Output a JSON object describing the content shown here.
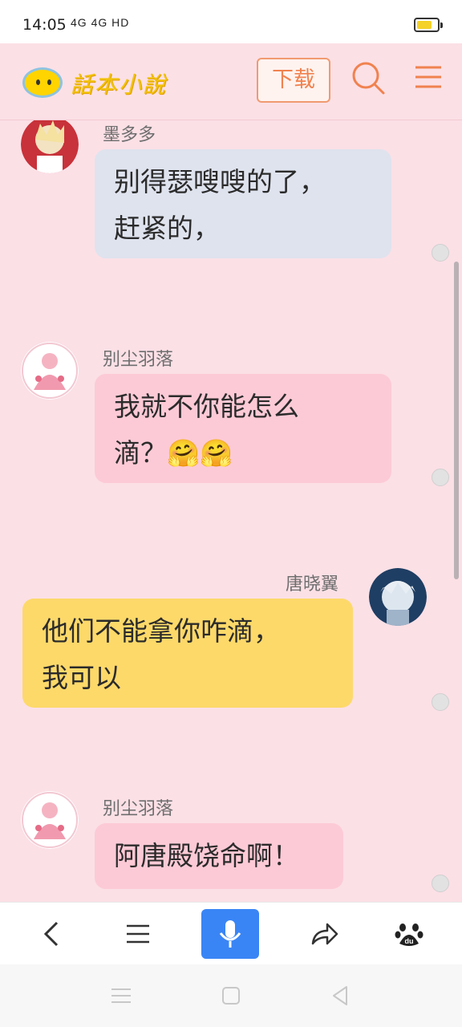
{
  "status": {
    "time": "14:05",
    "network": "4G 4G HD",
    "battery_level": 0.75
  },
  "header": {
    "app_name": "話本小說",
    "download_label": "下载"
  },
  "messages": [
    {
      "sender": "墨多多",
      "text_lines": [
        "别得瑟嗖嗖的了，",
        "赶紧的，"
      ],
      "side": "left",
      "color": "blue"
    },
    {
      "sender": "别尘羽落",
      "text_lines": [
        "我就不你能怎么",
        "滴？🤗🤗"
      ],
      "side": "left",
      "color": "pink"
    },
    {
      "sender": "唐晓翼",
      "text_lines": [
        "他们不能拿你咋滴，",
        "我可以"
      ],
      "side": "right",
      "color": "yellow"
    },
    {
      "sender": "别尘羽落",
      "text_lines": [
        "阿唐殿饶命啊！"
      ],
      "side": "left",
      "color": "pink"
    }
  ],
  "colors": {
    "bg": "#fbe0e6",
    "accent": "#f0824f",
    "mic": "#3a85f5"
  },
  "toolbar": {
    "icons": [
      "back-icon",
      "menu-lines-icon",
      "microphone-icon",
      "share-icon",
      "baidu-paw-icon"
    ]
  }
}
